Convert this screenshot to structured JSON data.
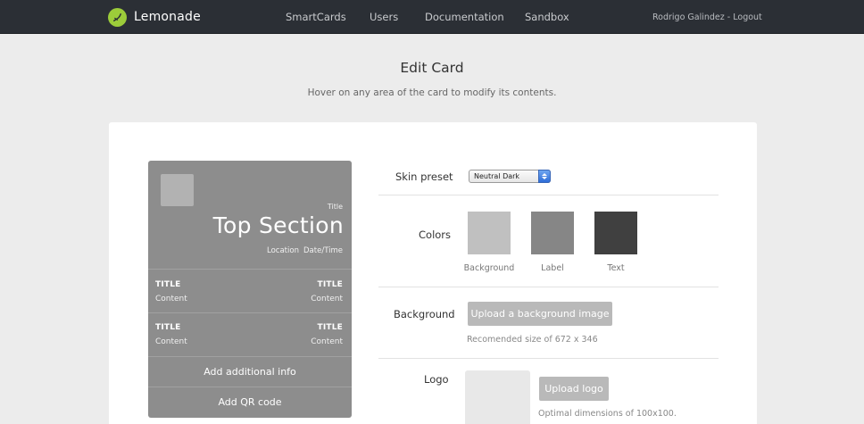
{
  "nav": {
    "brand": "Lemonade",
    "links": [
      {
        "label": "SmartCards"
      },
      {
        "label": "Users"
      },
      {
        "label": "Documentation"
      },
      {
        "label": "Sandbox"
      }
    ],
    "user_name": "Rodrigo Galindez",
    "separator": " - ",
    "logout": "Logout"
  },
  "page": {
    "title": "Edit Card",
    "subtitle": "Hover on any area of the card to modify its contents."
  },
  "card": {
    "title_small": "Title",
    "title_big": "Top Section",
    "location": "Location",
    "datetime": "Date/Time",
    "rows": [
      {
        "left_title": "TITLE",
        "left_content": "Content",
        "right_title": "TITLE",
        "right_content": "Content"
      },
      {
        "left_title": "TITLE",
        "left_content": "Content",
        "right_title": "TITLE",
        "right_content": "Content"
      }
    ],
    "add_info": "Add additional info",
    "add_qr": "Add QR code"
  },
  "form": {
    "skin": {
      "label": "Skin preset",
      "value": "Neutral Dark"
    },
    "colors": {
      "label": "Colors",
      "swatches": [
        {
          "name": "Background",
          "color": "#c0c0c0"
        },
        {
          "name": "Label",
          "color": "#868686"
        },
        {
          "name": "Text",
          "color": "#404040"
        }
      ]
    },
    "background": {
      "label": "Background",
      "button": "Upload a background image",
      "hint": "Recomended size of 672 x 346"
    },
    "logo": {
      "label": "Logo",
      "button": "Upload logo",
      "hint": "Optimal dimensions of 100x100."
    }
  },
  "colors": {
    "nav_bg": "#2b2f35",
    "brand_accent": "#9ccc3a",
    "card_bg": "#8d8d8d",
    "button_bg": "#b9b9b9"
  }
}
